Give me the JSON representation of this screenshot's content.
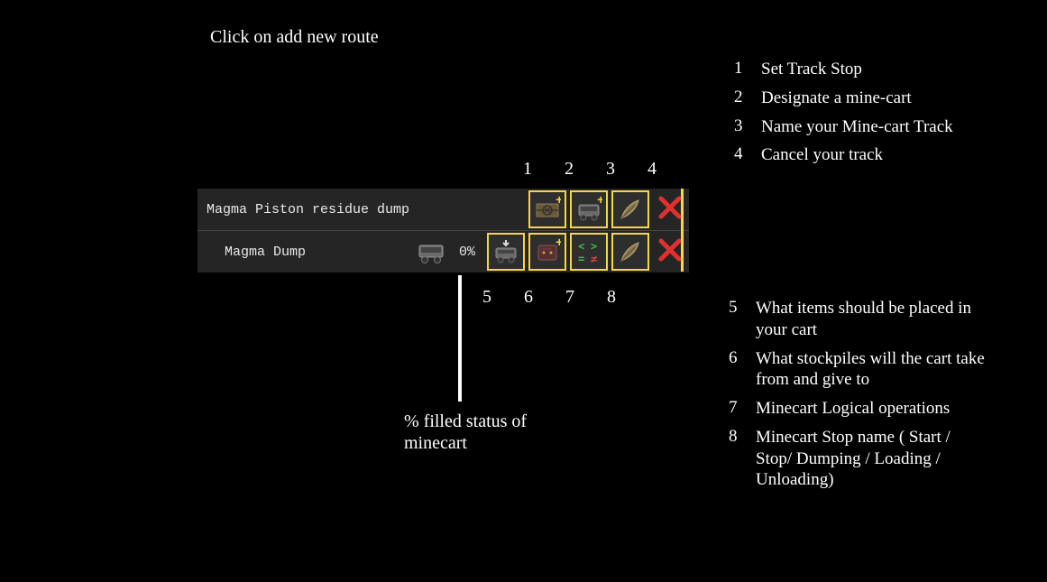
{
  "instruction": "Click on add new route",
  "panel": {
    "route_name": "Magma Piston residue dump",
    "stop_name": "Magma Dump",
    "fill_percent": "0%"
  },
  "labels_top": {
    "n1": "1",
    "n2": "2",
    "n3": "3",
    "n4": "4"
  },
  "labels_bottom": {
    "n5": "5",
    "n6": "6",
    "n7": "7",
    "n8": "8"
  },
  "legend_top": [
    {
      "n": "1",
      "t": "Set Track Stop"
    },
    {
      "n": "2",
      "t": "Designate a mine-cart"
    },
    {
      "n": "3",
      "t": "Name your Mine-cart Track"
    },
    {
      "n": "4",
      "t": "Cancel your track"
    }
  ],
  "legend_bottom": [
    {
      "n": "5",
      "t": "What items should be placed in your cart"
    },
    {
      "n": "6",
      "t": "What stockpiles will the cart take from and give to"
    },
    {
      "n": "7",
      "t": "Minecart Logical operations"
    },
    {
      "n": "8",
      "t": "Minecart Stop name ( Start / Stop/ Dumping / Loading / Unloading)"
    }
  ],
  "callout": "% filled status of minecart"
}
